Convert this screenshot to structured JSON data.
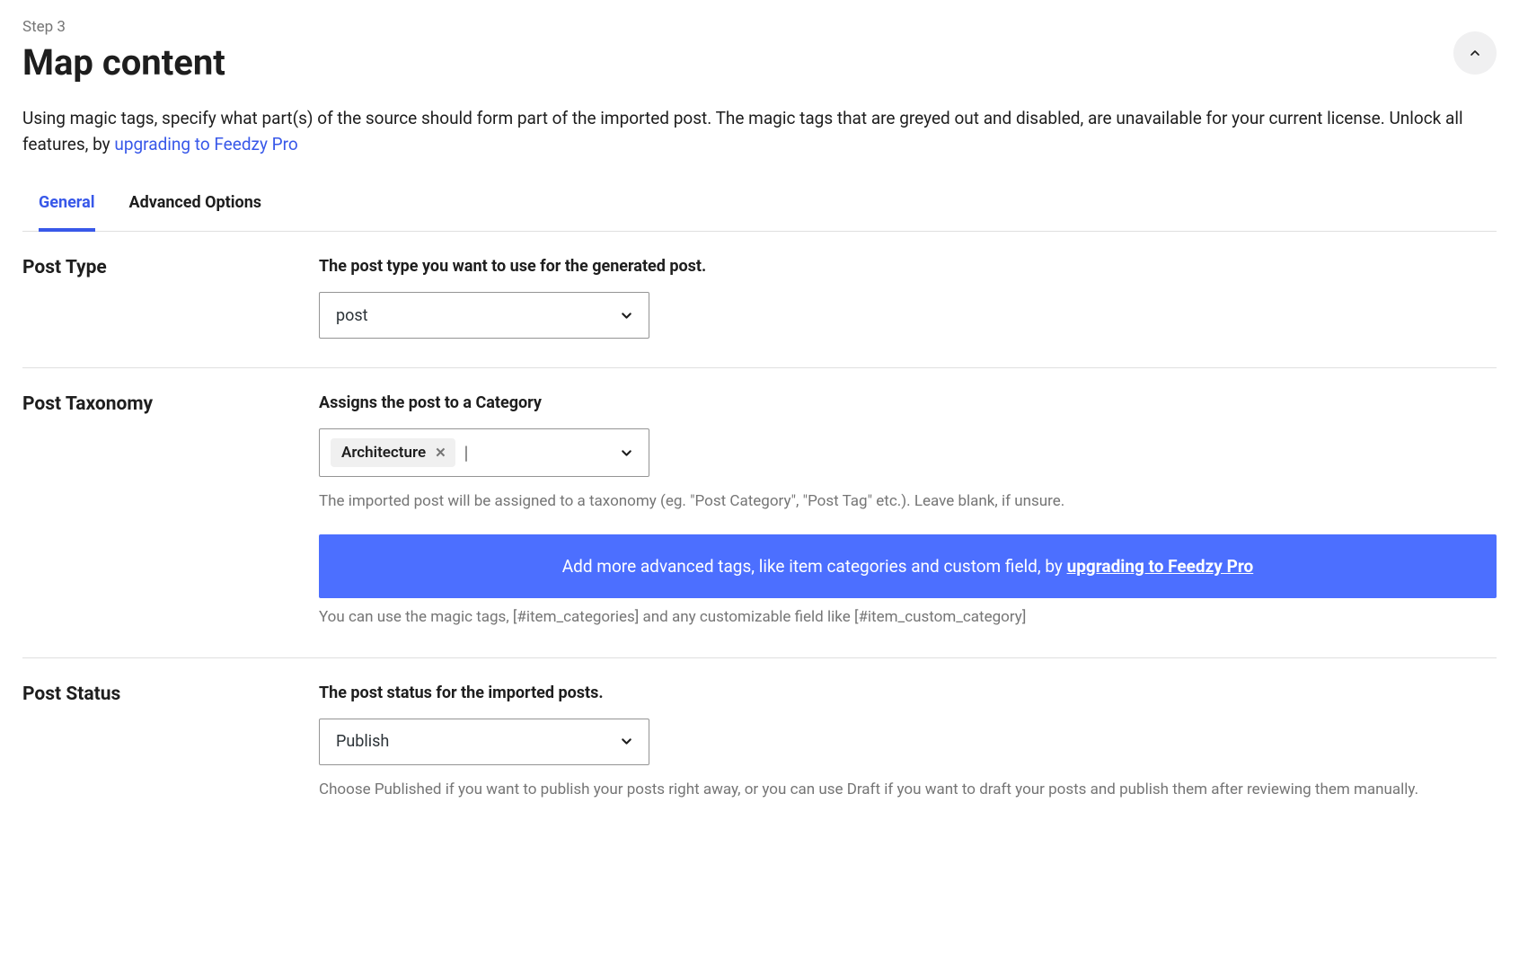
{
  "header": {
    "step": "Step 3",
    "title": "Map content"
  },
  "description": {
    "text_a": "Using magic tags, specify what part(s) of the source should form part of the imported post. The magic tags that are greyed out and disabled, are unavailable for your current license. Unlock all features, by ",
    "link": "upgrading to Feedzy Pro"
  },
  "tabs": {
    "general": "General",
    "advanced": "Advanced Options"
  },
  "sections": {
    "post_type": {
      "left": "Post Type",
      "label": "The post type you want to use for the generated post.",
      "value": "post"
    },
    "post_taxonomy": {
      "left": "Post Taxonomy",
      "label": "Assigns the post to a Category",
      "chip": "Architecture",
      "help1": "The imported post will be assigned to a taxonomy (eg. \"Post Category\", \"Post Tag\" etc.). Leave blank, if unsure.",
      "promo_a": "Add more advanced tags, like item categories and custom field, by ",
      "promo_link": "upgrading to Feedzy Pro",
      "help2": "You can use the magic tags, [#item_categories] and any customizable field like [#item_custom_category]"
    },
    "post_status": {
      "left": "Post Status",
      "label": "The post status for the imported posts.",
      "value": "Publish",
      "help": "Choose Published if you want to publish your posts right away, or you can use Draft if you want to draft your posts and publish them after reviewing them manually."
    }
  }
}
